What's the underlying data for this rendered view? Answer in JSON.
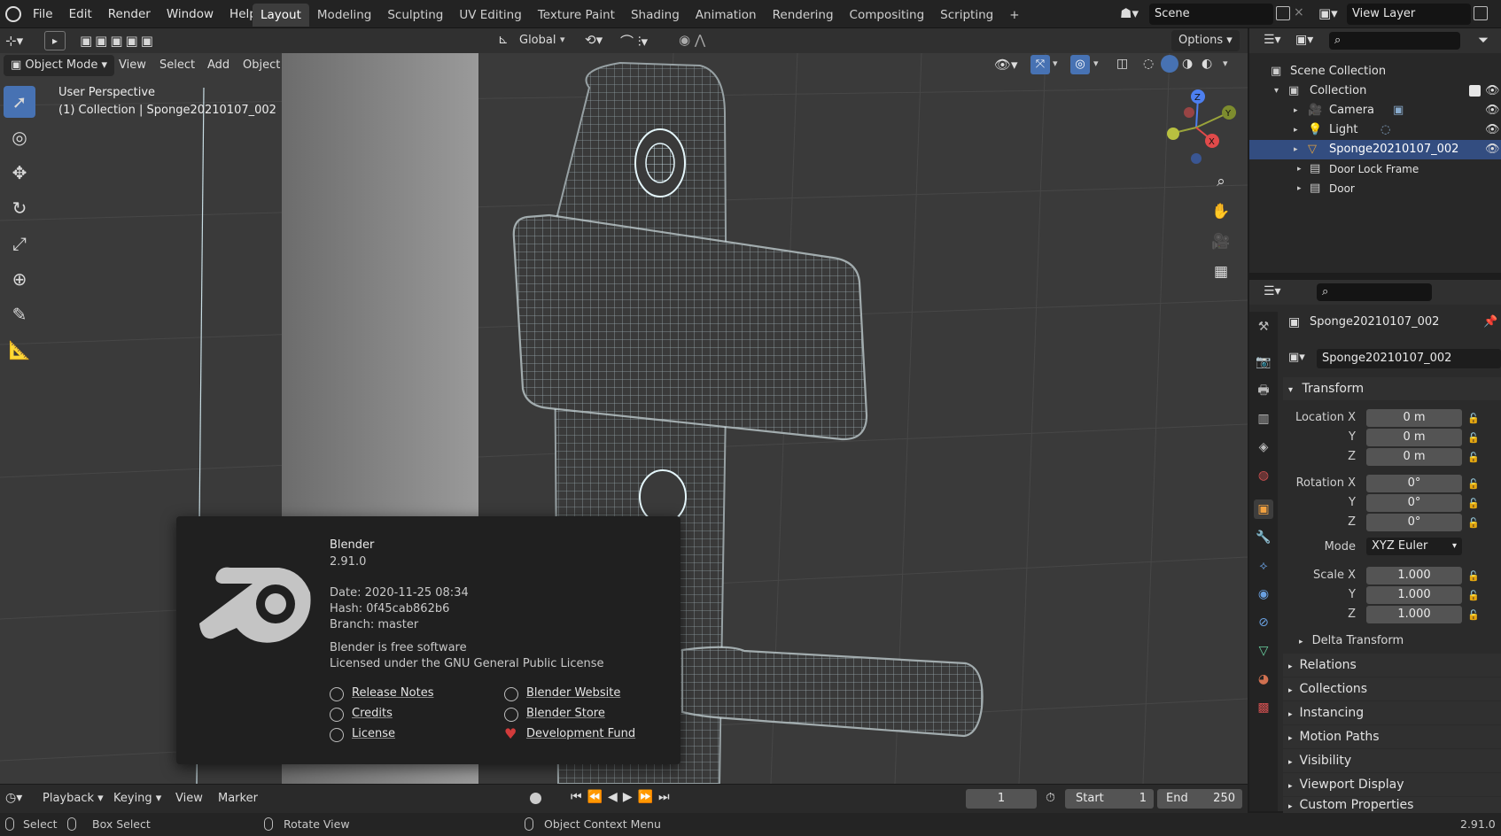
{
  "topbar": {
    "menu": [
      "File",
      "Edit",
      "Render",
      "Window",
      "Help"
    ],
    "workspaces": [
      "Layout",
      "Modeling",
      "Sculpting",
      "UV Editing",
      "Texture Paint",
      "Shading",
      "Animation",
      "Rendering",
      "Compositing",
      "Scripting"
    ],
    "active_workspace": "Layout",
    "add_tab": "+",
    "scene": "Scene",
    "view_layer": "View Layer"
  },
  "viewport_header": {
    "transform_orientation": "Global",
    "options": "Options",
    "mode": "Object Mode",
    "menus": [
      "View",
      "Select",
      "Add",
      "Object"
    ]
  },
  "viewport": {
    "perspective": "User Perspective",
    "collection_info": "(1) Collection | Sponge20210107_002",
    "gizmo_axes": [
      "Z",
      "Y",
      "X"
    ]
  },
  "splash": {
    "app": "Blender",
    "version": "2.91.0",
    "date": "Date: 2020-11-25 08:34",
    "hash": "Hash: 0f45cab862b6",
    "branch": "Branch: master",
    "free": "Blender is free software",
    "license_text": "Licensed under the GNU General Public License",
    "links_left": [
      "Release Notes",
      "Credits",
      "License"
    ],
    "links_right": [
      "Blender Website",
      "Blender Store",
      "Development Fund"
    ]
  },
  "outliner": {
    "scene_collection": "Scene Collection",
    "collection": "Collection",
    "items": [
      "Camera",
      "Light",
      "Sponge20210107_002",
      "Door Lock Frame",
      "Door"
    ]
  },
  "properties": {
    "object_name": "Sponge20210107_002",
    "data_name": "Sponge20210107_002",
    "transform": "Transform",
    "location_label": "Location X",
    "rotation_label": "Rotation X",
    "scale_label": "Scale X",
    "axis_y": "Y",
    "axis_z": "Z",
    "location": [
      "0 m",
      "0 m",
      "0 m"
    ],
    "rotation": [
      "0°",
      "0°",
      "0°"
    ],
    "mode_label": "Mode",
    "mode_value": "XYZ Euler",
    "scale": [
      "1.000",
      "1.000",
      "1.000"
    ],
    "delta_transform": "Delta Transform",
    "panels": [
      "Relations",
      "Collections",
      "Instancing",
      "Motion Paths",
      "Visibility",
      "Viewport Display",
      "Custom Properties"
    ]
  },
  "timeline": {
    "menus": [
      "Playback",
      "Keying",
      "View",
      "Marker"
    ],
    "current_frame": "1",
    "start_label": "Start",
    "start": "1",
    "end_label": "End",
    "end": "250"
  },
  "status": {
    "select": "Select",
    "box_select": "Box Select",
    "rotate_view": "Rotate View",
    "context_menu": "Object Context Menu",
    "version": "2.91.0"
  },
  "colors": {
    "accent": "#4772b3",
    "selected_row": "#334d80",
    "wire": "#bfe6f2"
  }
}
